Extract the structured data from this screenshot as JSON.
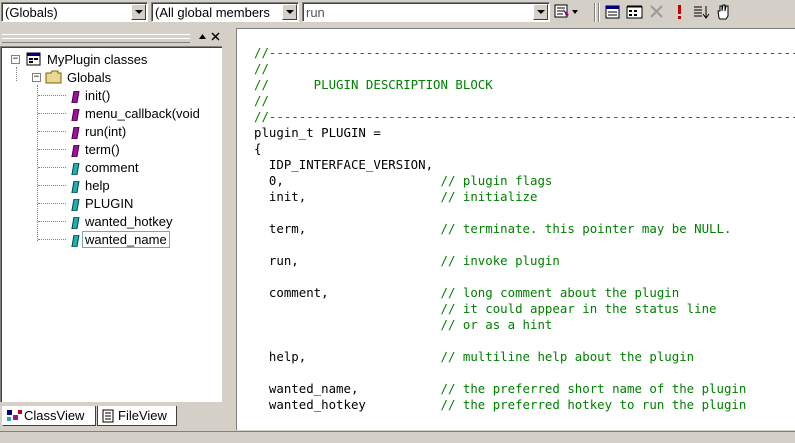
{
  "toolbar": {
    "scope_combo": "(Globals)",
    "members_combo": "(All global members",
    "function_combo": "run",
    "icons": [
      "wizard-action-icon",
      "goto-definition-icon",
      "new-class-icon",
      "delete-icon",
      "exclamation-icon",
      "sort-members-icon",
      "hand-icon"
    ]
  },
  "tree": {
    "root": "MyPlugin classes",
    "group": "Globals",
    "items": [
      {
        "label": "init()",
        "kind": "function"
      },
      {
        "label": "menu_callback(void",
        "kind": "function"
      },
      {
        "label": "run(int)",
        "kind": "function"
      },
      {
        "label": "term()",
        "kind": "function"
      },
      {
        "label": "comment",
        "kind": "variable"
      },
      {
        "label": "help",
        "kind": "variable"
      },
      {
        "label": "PLUGIN",
        "kind": "variable"
      },
      {
        "label": "wanted_hotkey",
        "kind": "variable"
      },
      {
        "label": "wanted_name",
        "kind": "variable",
        "selected": true
      }
    ]
  },
  "tabs": [
    {
      "label": "ClassView",
      "active": true
    },
    {
      "label": "FileView",
      "active": false
    }
  ],
  "code": [
    {
      "code": "",
      "comment": "//--------------------------------------------------------------------------"
    },
    {
      "code": "",
      "comment": "//"
    },
    {
      "code": "",
      "comment": "//      PLUGIN DESCRIPTION BLOCK"
    },
    {
      "code": "",
      "comment": "//"
    },
    {
      "code": "",
      "comment": "//--------------------------------------------------------------------------"
    },
    {
      "code": "plugin_t PLUGIN =",
      "comment": ""
    },
    {
      "code": "{",
      "comment": ""
    },
    {
      "code": "  IDP_INTERFACE_VERSION,",
      "comment": ""
    },
    {
      "code": "  0,                     ",
      "comment": "// plugin flags"
    },
    {
      "code": "  init,                  ",
      "comment": "// initialize"
    },
    {
      "code": "",
      "comment": ""
    },
    {
      "code": "  term,                  ",
      "comment": "// terminate. this pointer may be NULL."
    },
    {
      "code": "",
      "comment": ""
    },
    {
      "code": "  run,                   ",
      "comment": "// invoke plugin"
    },
    {
      "code": "",
      "comment": ""
    },
    {
      "code": "  comment,               ",
      "comment": "// long comment about the plugin"
    },
    {
      "code": "                         ",
      "comment": "// it could appear in the status line"
    },
    {
      "code": "                         ",
      "comment": "// or as a hint"
    },
    {
      "code": "",
      "comment": ""
    },
    {
      "code": "  help,                  ",
      "comment": "// multiline help about the plugin"
    },
    {
      "code": "",
      "comment": ""
    },
    {
      "code": "  wanted_name,           ",
      "comment": "// the preferred short name of the plugin"
    },
    {
      "code": "  wanted_hotkey          ",
      "comment": "// the preferred hotkey to run the plugin"
    }
  ],
  "colors": {
    "comment": "#008000",
    "face": "#d4d0c8",
    "selection_border": "#77aaaa"
  }
}
